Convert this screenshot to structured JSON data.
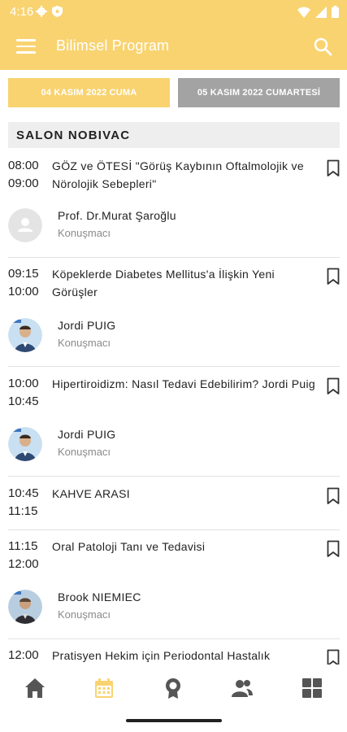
{
  "status_bar": {
    "time": "4:16"
  },
  "app_bar": {
    "title": "Bilimsel Program"
  },
  "date_tabs": [
    {
      "label": "04 KASIM 2022 CUMA",
      "active": true
    },
    {
      "label": "05 KASIM 2022 CUMARTESİ",
      "active": false
    }
  ],
  "section": {
    "title": "SALON  NOBIVAC"
  },
  "sessions": [
    {
      "start": "08:00",
      "end": "09:00",
      "title": "GÖZ ve ÖTESİ \"Görüş Kaybının Oftalmolojik ve Nörolojik Sebepleri\""
    },
    {
      "start": "09:15",
      "end": "10:00",
      "title": "Köpeklerde Diabetes Mellitus'a İlişkin Yeni Görüşler"
    },
    {
      "start": "10:00",
      "end": "10:45",
      "title": "Hipertiroidizm: Nasıl Tedavi Edebilirim? Jordi Puig"
    },
    {
      "start": "10:45",
      "end": "11:15",
      "title": "KAHVE ARASI"
    },
    {
      "start": "11:15",
      "end": "12:00",
      "title": "Oral Patoloji Tanı ve Tedavisi"
    },
    {
      "start": "12:00",
      "end": "",
      "title": "Pratisyen Hekim için Periodontal Hastalık"
    }
  ],
  "speakers": [
    {
      "name": "Prof. Dr.Murat Şaroğlu",
      "role": "Konuşmacı",
      "avatar": "placeholder"
    },
    {
      "name": "Jordi PUIG",
      "role": "Konuşmacı",
      "avatar": "photo"
    },
    {
      "name": "Jordi PUIG",
      "role": "Konuşmacı",
      "avatar": "photo"
    },
    {
      "name": "Brook NIEMIEC",
      "role": "Konuşmacı",
      "avatar": "photo"
    }
  ],
  "bottom_nav": [
    {
      "icon": "home-icon",
      "active": false
    },
    {
      "icon": "calendar-icon",
      "active": true
    },
    {
      "icon": "award-icon",
      "active": false
    },
    {
      "icon": "people-icon",
      "active": false
    },
    {
      "icon": "grid-icon",
      "active": false
    }
  ],
  "colors": {
    "accent": "#f8d370",
    "inactive_tab": "#a3a3a3",
    "nav_icon": "#555555"
  }
}
